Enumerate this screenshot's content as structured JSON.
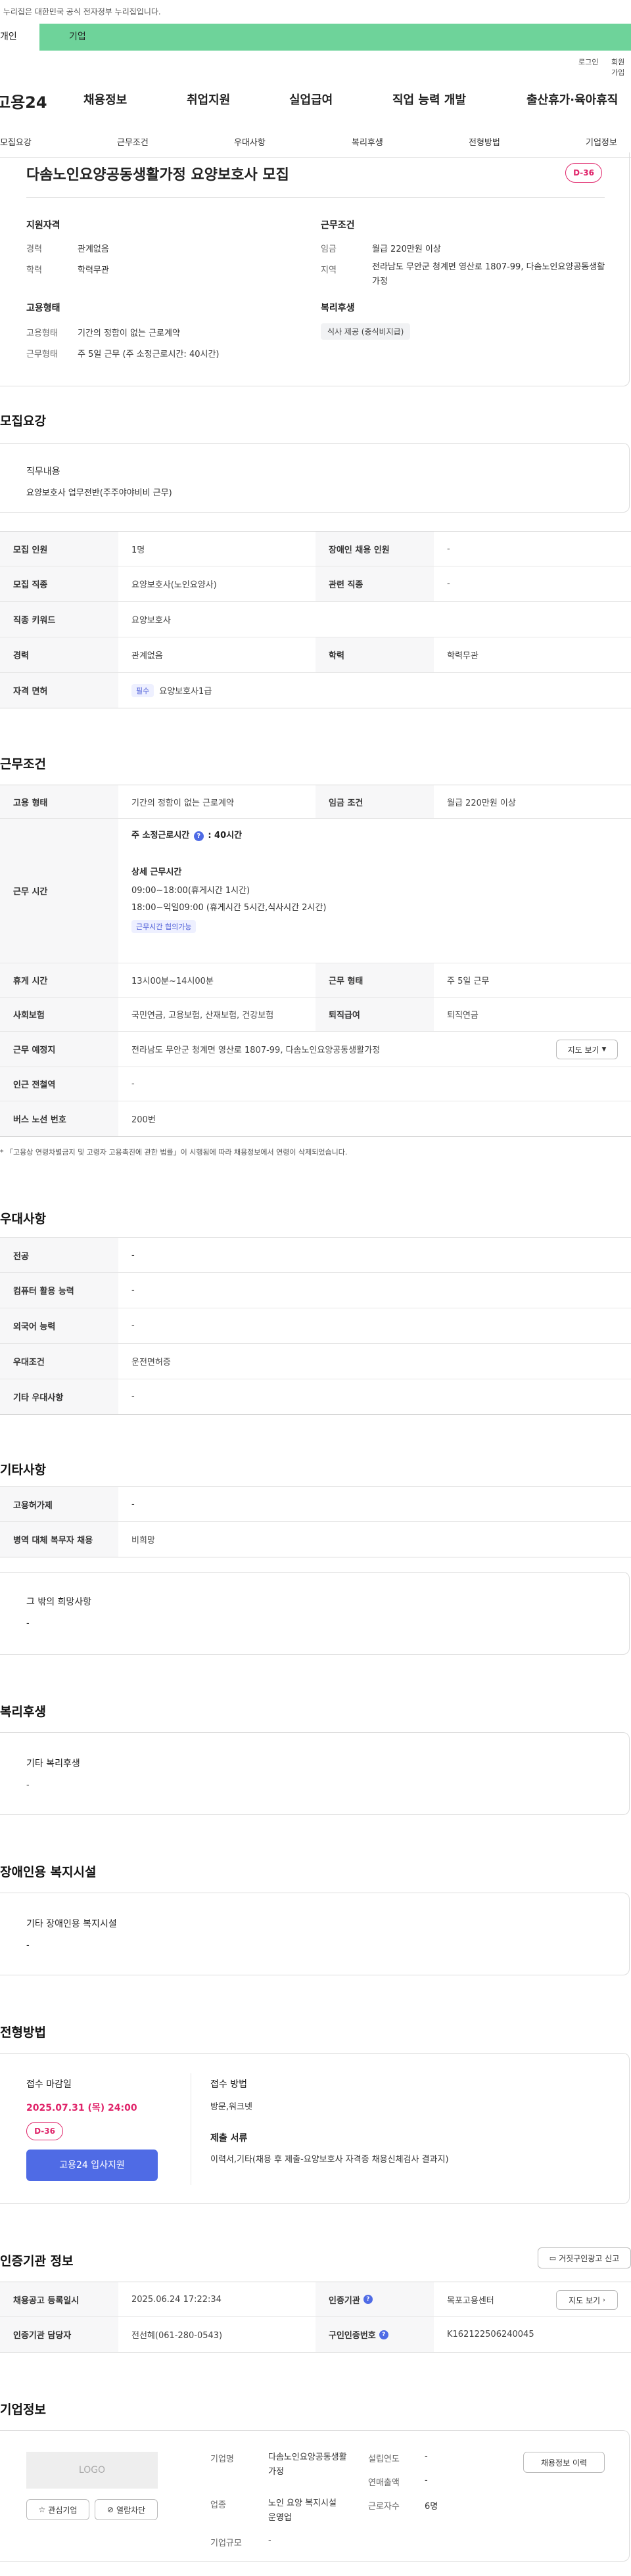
{
  "notice": {
    "text": "이 누리집은 대한민국 공식 전자정부 누리집입니다."
  },
  "user_tabs": [
    "개인",
    "기업"
  ],
  "util_links": [
    "로그인",
    "회원가입"
  ],
  "gnb": {
    "logo": "고용24",
    "items": [
      "채용정보",
      "취업지원",
      "실업급여",
      "직업 능력 개발",
      "출산휴가·육아휴직"
    ]
  },
  "section_nav": [
    "모집요강",
    "근무조건",
    "우대사항",
    "복리후생",
    "전형방법",
    "기업정보"
  ],
  "summary": {
    "title": "다솜노인요양공동생활가정 요양보호사 모집",
    "dday": "D-36",
    "qual": {
      "heading": "지원자격",
      "career_label": "경력",
      "career": "관계없음",
      "edu_label": "학력",
      "edu": "학력무관"
    },
    "work": {
      "heading": "근무조건",
      "wage_label": "임금",
      "wage": "월급 220만원 이상",
      "area_label": "지역",
      "area": "전라남도 무안군 청계면 영산로 1807-99, 다솜노인요양공동생활가정"
    },
    "employ": {
      "heading": "고용형태",
      "type_label": "고용형태",
      "type": "기간의 정함이 없는 근로계약",
      "form_label": "근무형태",
      "form": "주 5일 근무 (주 소정근로시간: 40시간)"
    },
    "welfare": {
      "heading": "복리후생",
      "tag": "식사 제공 (중식비지급)"
    }
  },
  "recruit": {
    "title": "모집요강",
    "job_heading": "직무내용",
    "job_content": "요양보호사 업무전반(주주야야비비 근무)",
    "rows": [
      {
        "h1": "모집 인원",
        "v1": "1명",
        "h2": "장애인 채용 인원",
        "v2": "-"
      },
      {
        "h1": "모집 직종",
        "v1": "요양보호사(노인요양사)",
        "h2": "관련 직종",
        "v2": "-"
      },
      {
        "h1": "직종 키워드",
        "v1": "요양보호사"
      },
      {
        "h1": "경력",
        "v1": "관계없음",
        "h2": "학력",
        "v2": "학력무관"
      },
      {
        "h1": "자격 면허",
        "badge": "필수",
        "v1": "요양보호사1급"
      }
    ]
  },
  "conditions": {
    "title": "근무조건",
    "employ_type_h": "고용 형태",
    "employ_type": "기간의 정함이 없는 근로계약",
    "wage_h": "임금 조건",
    "wage": "월급 220만원 이상",
    "worktime_h": "근무 시간",
    "weekly": "주 소정근로시간",
    "weekly_value": ": 40시간",
    "detail_h": "상세 근무시간",
    "detail1": "09:00~18:00(휴게시간 1시간)",
    "detail2": "18:00~익일09:00 (휴게시간 5시간,식사시간 2시간)",
    "negotiable": "근무시간 협의가능",
    "rest_h": "휴게 시간",
    "rest": "13시00분~14시00분",
    "form_h": "근무 형태",
    "form": "주 5일 근무",
    "insurance_h": "사회보험",
    "insurance": "국민연금, 고용보험, 산재보험, 건강보험",
    "severance_h": "퇴직급여",
    "severance": "퇴직연금",
    "place_h": "근무 예정지",
    "place": "전라남도 무안군 청계면 영산로 1807-99, 다솜노인요양공동생활가정",
    "map_btn": "지도 보기",
    "station_h": "인근 전철역",
    "station": "-",
    "bus_h": "버스 노선 번호",
    "bus": "200번",
    "footnote": "「고용상 연령차별금지 및 고령자 고용촉진에 관한 법률」이 시행됨에 따라 채용정보에서 연령이 삭제되었습니다."
  },
  "preference": {
    "title": "우대사항",
    "rows": [
      {
        "h": "전공",
        "v": "-"
      },
      {
        "h": "컴퓨터 활용 능력",
        "v": "-"
      },
      {
        "h": "외국어 능력",
        "v": "-"
      },
      {
        "h": "우대조건",
        "v": "운전면허증"
      },
      {
        "h": "기타 우대사항",
        "v": "-"
      }
    ]
  },
  "others": {
    "title": "기타사항",
    "rows": [
      {
        "h": "고용허가제",
        "v": "-"
      },
      {
        "h": "병역 대체 복무자 채용",
        "v": "비희망"
      }
    ],
    "extra_h": "그 밖의 희망사항",
    "extra_v": "-"
  },
  "welfare": {
    "title": "복리후생",
    "h": "기타 복리후생",
    "v": "-"
  },
  "disability": {
    "title": "장애인용 복지시설",
    "h": "기타 장애인용 복지시설",
    "v": "-"
  },
  "process": {
    "title": "전형방법",
    "deadline_h": "접수 마감일",
    "deadline": "2025.07.31 (목) 24:00",
    "dday": "D-36",
    "apply_btn": "고용24 입사지원",
    "method_h": "접수 방법",
    "method": "방문,워크넷",
    "docs_h": "제출 서류",
    "docs": "이력서,기타(채용 후 제출-요양보호사 자격증 채용신체검사 결과지)"
  },
  "agency": {
    "title": "인증기관 정보",
    "report_btn": "거짓구인광고 신고",
    "reg_h": "채용공고 등록일시",
    "reg": "2025.06.24 17:22:34",
    "cert_h": "인증기관",
    "cert": "목포고용센터",
    "map_btn": "지도 보기",
    "manager_h": "인증기관 담당자",
    "manager": "전선혜(061-280-0543)",
    "no_h": "구인인증번호",
    "no": "K162122506240045"
  },
  "company": {
    "title": "기업정보",
    "logo": "LOGO",
    "fav_btn": "관심기업",
    "block_btn": "열람차단",
    "name_h": "기업명",
    "name": "다솜노인요양공동생활가정",
    "industry_h": "업종",
    "industry": "노인 요양 복지시설 운영업",
    "size_h": "기업규모",
    "size": "-",
    "year_h": "설립연도",
    "year": "-",
    "sales_h": "연매출액",
    "sales": "-",
    "staff_h": "근로자수",
    "staff": "6명",
    "history_btn": "채용정보 이력"
  },
  "colors": {
    "accent": "#6ed39a",
    "accent_dark": "#3fbf7a",
    "primary_btn": "#4f6be5",
    "dday": "#e0246a",
    "badge_bg": "#eef0ff",
    "badge_fg": "#4f5fd8"
  }
}
